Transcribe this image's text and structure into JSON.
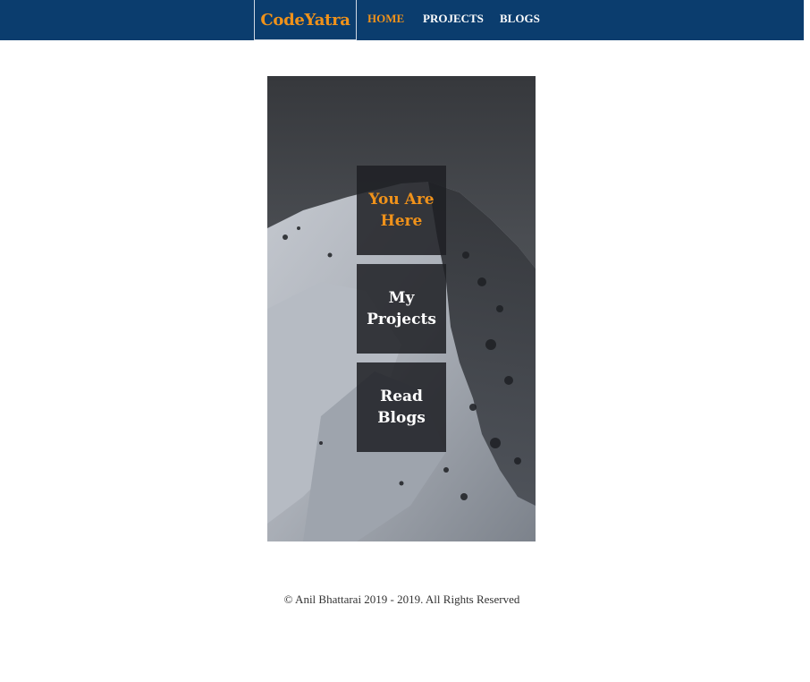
{
  "nav": {
    "brand": "CodeYatra",
    "links": [
      {
        "label": "HOME",
        "active": true
      },
      {
        "label": "PROJECTS",
        "active": false
      },
      {
        "label": "BLOGS",
        "active": false
      }
    ],
    "background_color": "#0b3d6e",
    "accent_color": "#f0921a"
  },
  "hero": {
    "image": "snowy-mountain-peak-photo",
    "tiles": [
      {
        "label": "You Are Here",
        "current": true
      },
      {
        "label": "My Projects",
        "current": false
      },
      {
        "label": "Read Blogs",
        "current": false
      }
    ]
  },
  "footer": {
    "text": "© Anil Bhattarai 2019 - 2019. All Rights Reserved"
  }
}
